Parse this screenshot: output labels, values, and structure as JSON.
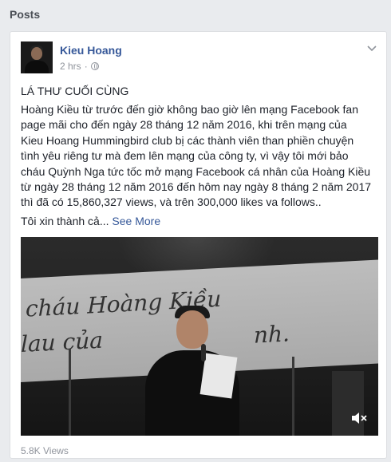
{
  "section": {
    "title": "Posts"
  },
  "post": {
    "author": "Kieu Hoang",
    "time": "2 hrs",
    "privacy_icon": "globe-icon",
    "menu_icon": "chevron-down-icon",
    "title": "LÁ THƯ CUỐI CÙNG",
    "body_lines": [
      "Hoàng Kiều từ trước đến giờ không bao giờ lên mạng Facebook fan",
      "page mãi cho đến ngày 28 tháng 12 năm 2016, khi trên mạng của",
      "Kieu Hoang Hummingbird club bị các thành viên than phiền chuyện",
      "tình yêu riêng tư mà đem lên mạng của công ty, vì vậy tôi mới bảo",
      "cháu Quỳnh Nga tức tốc mở mạng Facebook cá nhân của Hoàng Kiều",
      "từ ngày 28 tháng 12 năm 2016 đến hôm nay ngày 8 tháng 2 năm 2017",
      "thì đã có 15,860,327 views, và trên 300,000 likes va follows.."
    ],
    "teaser": "Tôi xin thành cả...",
    "see_more": "See More",
    "video": {
      "screen_text_1": "cháu Hoàng Kiều",
      "screen_text_2": "lau của",
      "screen_text_3": "nh.",
      "mute_icon": "speaker-muted-icon"
    },
    "views": "5.8K Views"
  },
  "colors": {
    "link": "#365899",
    "muted": "#90949c",
    "text": "#1d2129",
    "page_bg": "#e9ebee"
  }
}
